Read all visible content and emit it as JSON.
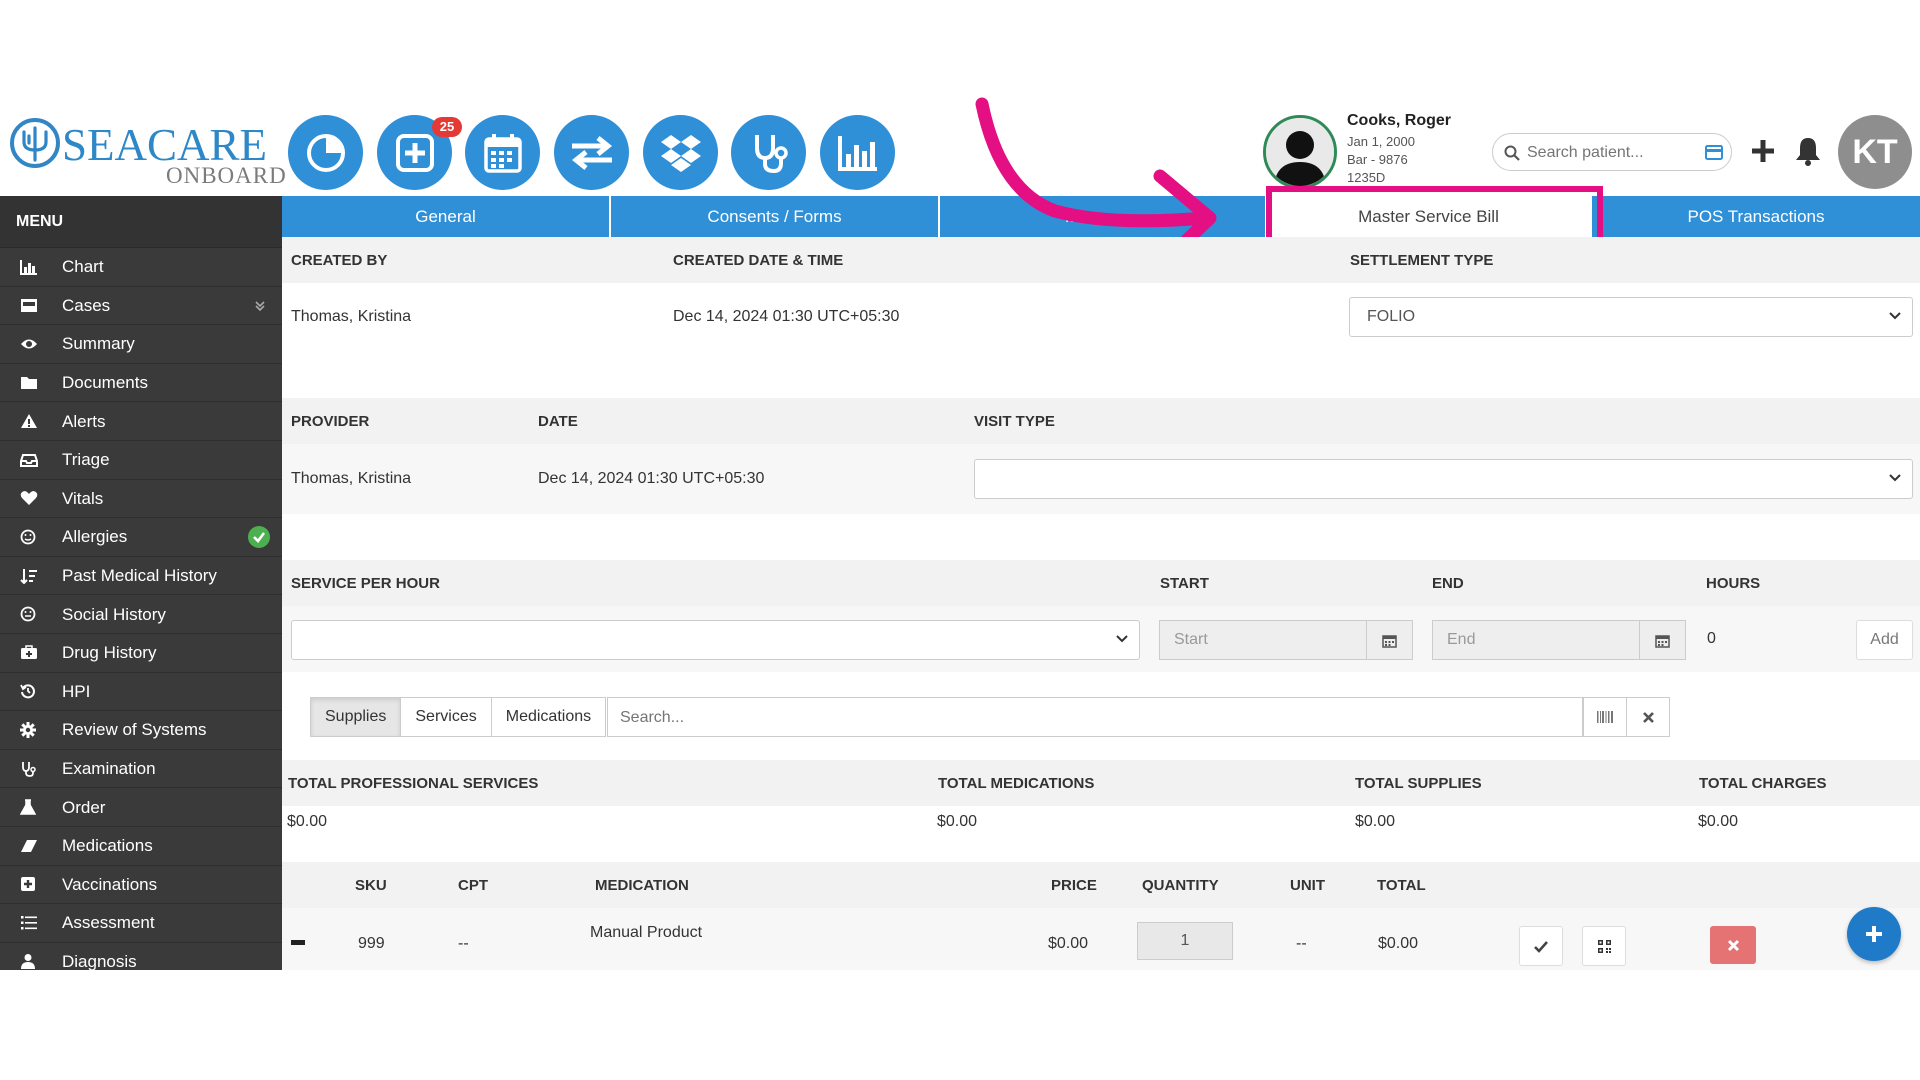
{
  "logo": {
    "text": "SEACARE",
    "sub": "ONBOARD"
  },
  "header": {
    "badge_count": "25",
    "toolbar_icons": [
      "dashboard-pie-icon",
      "add-case-icon",
      "calendar-icon",
      "transfer-icon",
      "dropbox-icon",
      "stethoscope-icon",
      "reports-bar-icon"
    ],
    "patient": {
      "name": "Cooks, Roger",
      "dob": "Jan 1, 2000",
      "bar": "Bar - 9876",
      "id": "1235D"
    },
    "search_placeholder": "Search patient...",
    "user_initials": "KT"
  },
  "sidebar": {
    "title": "MENU",
    "items": [
      {
        "label": "Chart",
        "icon": "bar-chart-icon"
      },
      {
        "label": "Cases",
        "icon": "inbox-icon"
      },
      {
        "label": "Summary",
        "icon": "eye-icon"
      },
      {
        "label": "Documents",
        "icon": "folder-icon"
      },
      {
        "label": "Alerts",
        "icon": "warning-icon"
      },
      {
        "label": "Triage",
        "icon": "tray-icon"
      },
      {
        "label": "Vitals",
        "icon": "heart-icon"
      },
      {
        "label": "Allergies",
        "icon": "smile-icon"
      },
      {
        "label": "Past Medical History",
        "icon": "sort-icon"
      },
      {
        "label": "Social History",
        "icon": "smile-icon"
      },
      {
        "label": "Drug History",
        "icon": "medkit-icon"
      },
      {
        "label": "HPI",
        "icon": "history-icon"
      },
      {
        "label": "Review of Systems",
        "icon": "cog-icon"
      },
      {
        "label": "Examination",
        "icon": "stethoscope-icon"
      },
      {
        "label": "Order",
        "icon": "flask-icon"
      },
      {
        "label": "Medications",
        "icon": "eraser-icon"
      },
      {
        "label": "Vaccinations",
        "icon": "plus-square-icon"
      },
      {
        "label": "Assessment",
        "icon": "list-icon"
      },
      {
        "label": "Diagnosis",
        "icon": "user-md-icon"
      }
    ]
  },
  "tabs": [
    {
      "label": "General"
    },
    {
      "label": "Consents / Forms"
    },
    {
      "label": "M..."
    },
    {
      "label": "Master Service Bill"
    },
    {
      "label": "POS Transactions"
    }
  ],
  "section1": {
    "created_by_label": "CREATED BY",
    "created_dt_label": "CREATED DATE & TIME",
    "settlement_label": "SETTLEMENT TYPE",
    "created_by": "Thomas, Kristina",
    "created_dt": "Dec 14, 2024 01:30 UTC+05:30",
    "settlement": "FOLIO"
  },
  "section2": {
    "provider_label": "PROVIDER",
    "date_label": "DATE",
    "visit_label": "VISIT TYPE",
    "provider": "Thomas, Kristina",
    "date": "Dec 14, 2024 01:30 UTC+05:30",
    "visit_type": ""
  },
  "section3": {
    "service_label": "SERVICE PER HOUR",
    "start_label": "START",
    "end_label": "END",
    "hours_label": "HOURS",
    "start_placeholder": "Start",
    "end_placeholder": "End",
    "hours": "0",
    "add_label": "Add"
  },
  "filters": {
    "segments": [
      "Supplies",
      "Services",
      "Medications"
    ],
    "search_placeholder": "Search..."
  },
  "totals": {
    "labels": [
      "TOTAL PROFESSIONAL SERVICES",
      "TOTAL MEDICATIONS",
      "TOTAL SUPPLIES",
      "TOTAL CHARGES"
    ],
    "values": [
      "$0.00",
      "$0.00",
      "$0.00",
      "$0.00"
    ]
  },
  "table": {
    "headers": [
      "SKU",
      "CPT",
      "MEDICATION",
      "PRICE",
      "QUANTITY",
      "UNIT",
      "TOTAL"
    ],
    "rows": [
      {
        "sku": "999",
        "cpt": "--",
        "medication": "Manual Product",
        "price": "$0.00",
        "quantity": "1",
        "unit": "--",
        "total": "$0.00"
      }
    ]
  },
  "colors": {
    "primary": "#2f8fd7",
    "highlight": "#e30f83",
    "sidebar": "#3a3a3a",
    "danger": "#e57373"
  }
}
